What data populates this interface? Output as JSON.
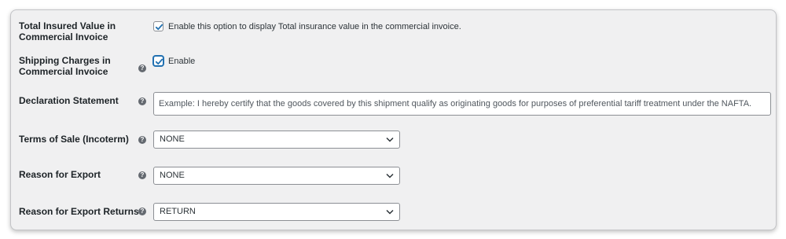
{
  "rows": {
    "insured_value": {
      "label_line1": "Total Insured Value in",
      "label_line2": "Commercial Invoice",
      "checkbox_checked": true,
      "checkbox_text": "Enable this option to display Total insurance value in the commercial invoice."
    },
    "shipping_charges": {
      "label_line1": "Shipping Charges in",
      "label_line2": "Commercial Invoice",
      "help_icon": "question-icon",
      "checkbox_checked": true,
      "checkbox_text": "Enable"
    },
    "declaration": {
      "label": "Declaration Statement",
      "help_icon": "question-icon",
      "value": "Example: I hereby certify that the goods covered by this shipment qualify as originating goods for purposes of preferential tariff treatment under the NAFTA."
    },
    "terms_of_sale": {
      "label": "Terms of Sale (Incoterm)",
      "help_icon": "question-icon",
      "selected": "NONE"
    },
    "reason_export": {
      "label": "Reason for Export",
      "help_icon": "question-icon",
      "selected": "NONE"
    },
    "reason_export_returns": {
      "label": "Reason for Export Returns",
      "help_icon": "question-icon",
      "selected": "RETURN"
    }
  },
  "help_glyph": "?",
  "colors": {
    "panel_bg": "#f0f0f1",
    "accent": "#2271b1",
    "help_bg": "#646970"
  }
}
